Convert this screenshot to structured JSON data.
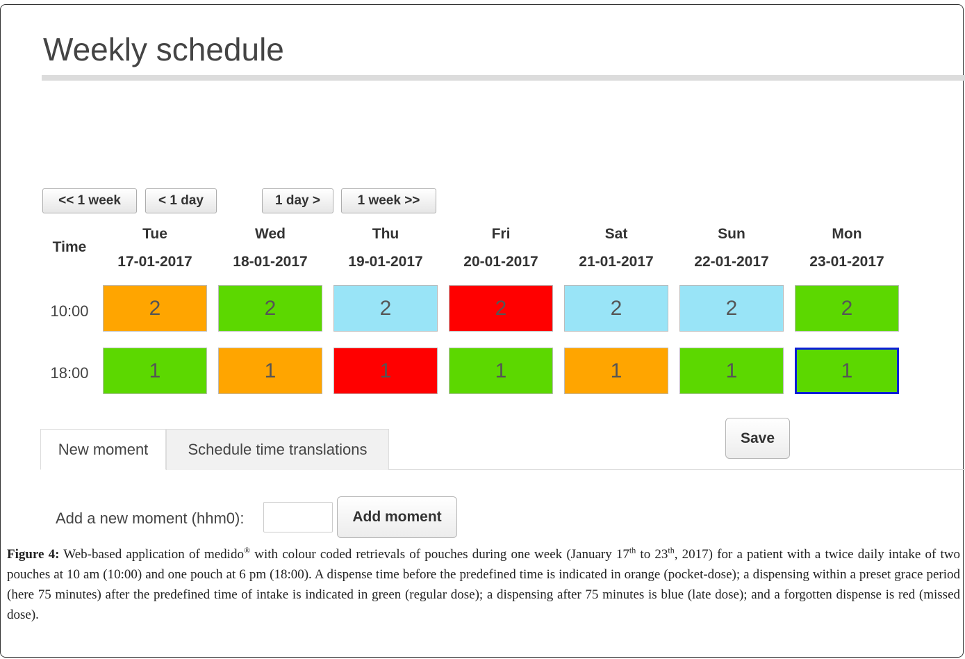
{
  "page": {
    "title": "Weekly schedule"
  },
  "nav": {
    "back_week": "<< 1 week",
    "back_day": "< 1 day",
    "fwd_day": "1 day >",
    "fwd_week": "1 week >>"
  },
  "table": {
    "time_header": "Time",
    "days": [
      {
        "name": "Tue",
        "date": "17-01-2017"
      },
      {
        "name": "Wed",
        "date": "18-01-2017"
      },
      {
        "name": "Thu",
        "date": "19-01-2017"
      },
      {
        "name": "Fri",
        "date": "20-01-2017"
      },
      {
        "name": "Sat",
        "date": "21-01-2017"
      },
      {
        "name": "Sun",
        "date": "22-01-2017"
      },
      {
        "name": "Mon",
        "date": "23-01-2017"
      }
    ],
    "rows": [
      {
        "time": "10:00",
        "cells": [
          {
            "value": "2",
            "color": "#ffa500"
          },
          {
            "value": "2",
            "color": "#5cd800"
          },
          {
            "value": "2",
            "color": "#99e4f7"
          },
          {
            "value": "2",
            "color": "#ff0000"
          },
          {
            "value": "2",
            "color": "#99e4f7"
          },
          {
            "value": "2",
            "color": "#99e4f7"
          },
          {
            "value": "2",
            "color": "#5cd800"
          }
        ]
      },
      {
        "time": "18:00",
        "cells": [
          {
            "value": "1",
            "color": "#5cd800"
          },
          {
            "value": "1",
            "color": "#ffa500"
          },
          {
            "value": "1",
            "color": "#ff0000"
          },
          {
            "value": "1",
            "color": "#5cd800"
          },
          {
            "value": "1",
            "color": "#ffa500"
          },
          {
            "value": "1",
            "color": "#5cd800"
          },
          {
            "value": "1",
            "color": "#5cd800",
            "selected": true
          }
        ]
      }
    ]
  },
  "save_label": "Save",
  "tabs": [
    {
      "label": "New moment",
      "active": true
    },
    {
      "label": "Schedule time translations",
      "active": false
    }
  ],
  "add_moment": {
    "label": "Add a new moment (hhm0):",
    "value": "",
    "button": "Add moment"
  },
  "caption": {
    "lead": "Figure 4:",
    "p1": " Web-based application of medido",
    "p2": " with colour coded retrievals of pouches during one week (January 17",
    "sup1": "th",
    "p3": " to 23",
    "sup2": "th",
    "p4": ", 2017) for a patient with a twice daily intake of two pouches at 10 am (10:00) and one pouch at 6 pm (18:00). A dispense time before the predefined time is indicated in orange (pocket-dose); a dispensing within a preset grace period (here 75 minutes) after the predefined time of intake is indicated in green (regular dose); a dispensing after 75 minutes is blue (late dose); and a forgotten dispense is red (missed dose)."
  }
}
